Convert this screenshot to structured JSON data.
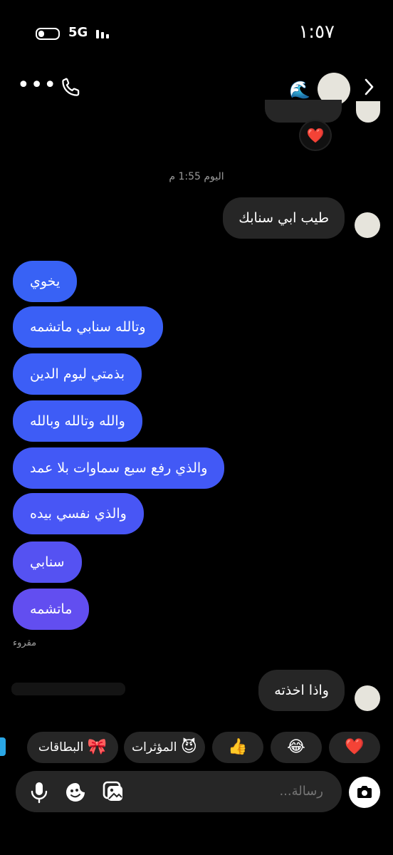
{
  "status_bar": {
    "time": "١:٥٧",
    "network": "5G"
  },
  "header": {
    "wave_emoji": "🌊"
  },
  "partial_message": {
    "reaction": "❤️"
  },
  "timestamp": "اليوم 1:55 م",
  "incoming_messages": [
    {
      "text": "طيب ابي سنابك"
    },
    {
      "text": "واذا اخذته"
    }
  ],
  "outgoing_messages": [
    {
      "text": "يخوي",
      "color": "#3862f5"
    },
    {
      "text": "وتالله سنابي ماتشمه",
      "color": "#3a60f6"
    },
    {
      "text": "بذمتي ليوم الدين",
      "color": "#3c5ef6"
    },
    {
      "text": "والله وتالله وبالله",
      "color": "#3e5cf6"
    },
    {
      "text": "والذي رفع سبع سماوات بلا عمد",
      "color": "#4259f6"
    },
    {
      "text": "والذي نفسي بيده",
      "color": "#4856f5"
    },
    {
      "text": "سنابي",
      "color": "#5552f2"
    },
    {
      "text": "ماتشمه",
      "color": "#624ef0"
    }
  ],
  "read_status": "مقروء",
  "quick_replies": [
    {
      "emoji": "❤️",
      "label": ""
    },
    {
      "emoji": "😂",
      "label": ""
    },
    {
      "emoji": "👍",
      "label": ""
    },
    {
      "emoji": "😈",
      "label": "المؤثرات"
    },
    {
      "emoji": "🎀",
      "label": "البطاقات"
    }
  ],
  "composer": {
    "placeholder": "رسالة..."
  },
  "icons": [
    "battery-icon",
    "signal-icon",
    "more-icon",
    "phone-icon",
    "chevron-right-icon",
    "wave-icon",
    "heart-icon",
    "mic-icon",
    "sticker-icon",
    "gallery-icon",
    "camera-icon"
  ]
}
